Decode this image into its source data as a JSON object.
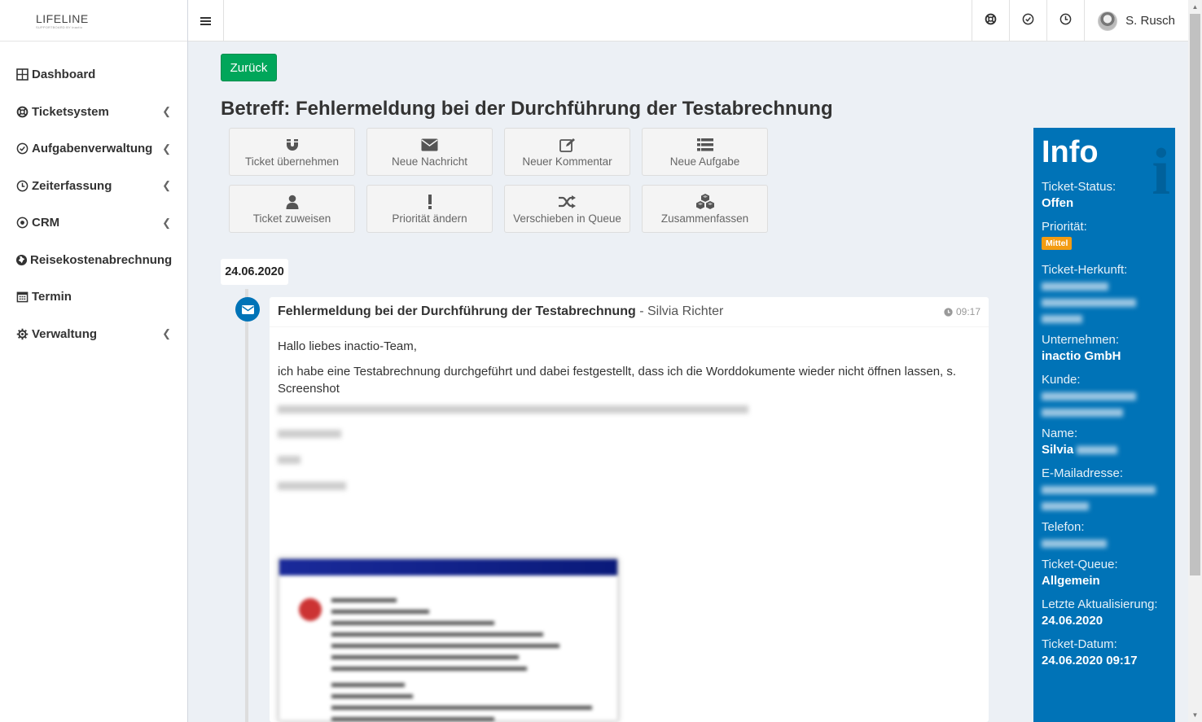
{
  "app": {
    "logo_main": "LIFELINE",
    "logo_sub": "SUPPORTBOARD BY inactio"
  },
  "sidebar": {
    "items": [
      {
        "label": "Dashboard",
        "icon": "dashboard-icon",
        "has_submenu": false
      },
      {
        "label": "Ticketsystem",
        "icon": "lifebuoy-icon",
        "has_submenu": true
      },
      {
        "label": "Aufgabenverwaltung",
        "icon": "check-circle-icon",
        "has_submenu": true
      },
      {
        "label": "Zeiterfassung",
        "icon": "clock-icon",
        "has_submenu": true
      },
      {
        "label": "CRM",
        "icon": "dot-circle-icon",
        "has_submenu": true
      },
      {
        "label": "Reisekostenabrechnung",
        "icon": "globe-icon",
        "has_submenu": false
      },
      {
        "label": "Termin",
        "icon": "calendar-icon",
        "has_submenu": false
      },
      {
        "label": "Verwaltung",
        "icon": "gear-icon",
        "has_submenu": true
      }
    ]
  },
  "topbar": {
    "user_name": "S. Rusch"
  },
  "page": {
    "back_label": "Zurück",
    "title_prefix": "Betreff:",
    "title_subject": "Fehlermeldung bei der Durchführung der Testabrechnung"
  },
  "actions": [
    {
      "label": "Ticket übernehmen",
      "icon": "magnet-icon"
    },
    {
      "label": "Neue Nachricht",
      "icon": "envelope-icon"
    },
    {
      "label": "Neuer Kommentar",
      "icon": "edit-icon"
    },
    {
      "label": "Neue Aufgabe",
      "icon": "list-icon"
    },
    {
      "label": "Ticket zuweisen",
      "icon": "user-icon"
    },
    {
      "label": "Priorität ändern",
      "icon": "exclamation-icon"
    },
    {
      "label": "Verschieben in Queue",
      "icon": "shuffle-icon"
    },
    {
      "label": "Zusammenfassen",
      "icon": "cubes-icon"
    }
  ],
  "timeline": {
    "date": "24.06.2020",
    "message": {
      "subject": "Fehlermeldung bei der Durchführung der Testabrechnung",
      "sender": "Silvia Richter",
      "time": "09:17",
      "greeting": "Hallo liebes inactio-Team,",
      "body": "ich habe eine Testabrechnung durchgeführt und dabei festgestellt, dass ich die Worddokumente wieder nicht öffnen lassen, s. Screenshot"
    }
  },
  "info": {
    "title": "Info",
    "fields": {
      "status_label": "Ticket-Status:",
      "status_value": "Offen",
      "priority_label": "Priorität:",
      "priority_value": "Mittel",
      "origin_label": "Ticket-Herkunft:",
      "company_label": "Unternehmen:",
      "company_value": "inactio GmbH",
      "customer_label": "Kunde:",
      "name_label": "Name:",
      "name_value": "Silvia",
      "email_label": "E-Mailadresse:",
      "phone_label": "Telefon:",
      "queue_label": "Ticket-Queue:",
      "queue_value": "Allgemein",
      "updated_label": "Letzte Aktualisierung:",
      "updated_value": "24.06.2020",
      "date_label": "Ticket-Datum:",
      "date_value": "24.06.2020 09:17"
    },
    "colors": {
      "panel": "#0073b7",
      "priority_badge": "#f39c12"
    }
  }
}
